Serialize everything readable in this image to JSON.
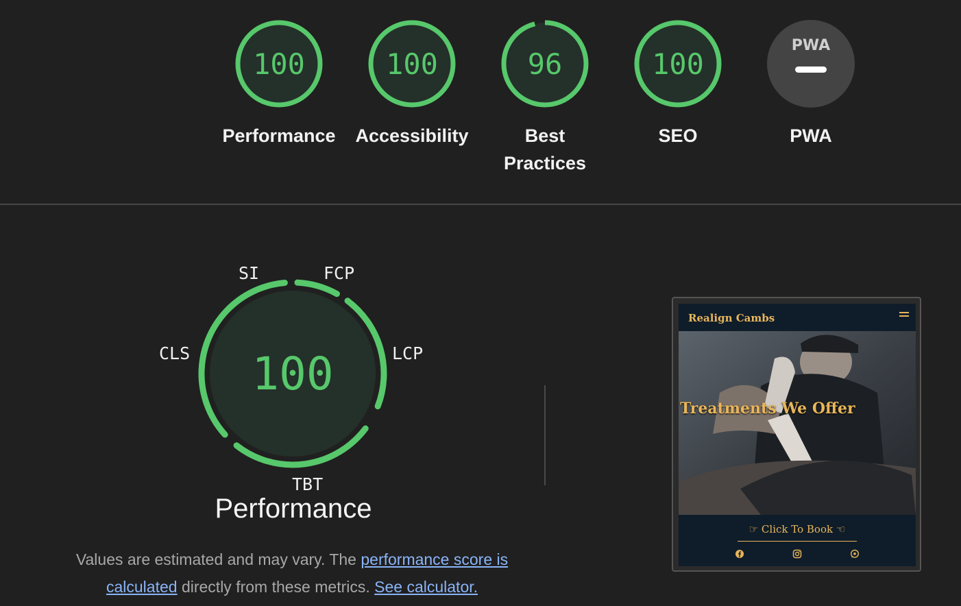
{
  "gauges": [
    {
      "score": "100",
      "label": "Performance",
      "fraction": 1.0
    },
    {
      "score": "100",
      "label": "Accessibility",
      "fraction": 1.0
    },
    {
      "score": "96",
      "label": "Best Practices",
      "fraction": 0.96
    },
    {
      "score": "100",
      "label": "SEO",
      "fraction": 1.0
    },
    {
      "badge": "PWA",
      "label": "PWA"
    }
  ],
  "performance": {
    "score": "100",
    "title": "Performance",
    "metrics": [
      "SI",
      "FCP",
      "LCP",
      "TBT",
      "CLS"
    ],
    "note_prefix": "Values are estimated and may vary. The ",
    "note_link1": "performance score is calculated",
    "note_middle": " directly from these metrics. ",
    "note_link2": "See calculator."
  },
  "screenshot": {
    "site_title": "Realign Cambs",
    "hero_heading": "Treatments We Offer",
    "cta": "☞ Click To Book ☜",
    "social_icons": [
      "facebook-icon",
      "instagram-icon",
      "whatsapp-icon"
    ]
  },
  "colors": {
    "pass_green": "#57c86b",
    "gauge_fill": "#24302a",
    "pwa_gray": "#444444",
    "link_blue": "#8ab4f8",
    "brand_gold": "#e9b65a"
  }
}
